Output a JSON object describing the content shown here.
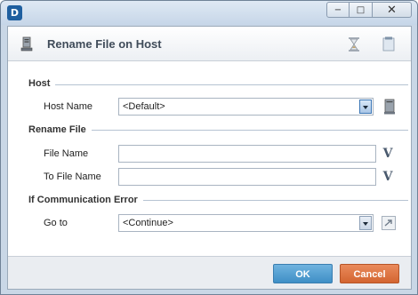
{
  "window": {
    "app_icon_text": "D",
    "minimize_glyph": "−",
    "maximize_glyph": "□",
    "close_glyph": "✕"
  },
  "header": {
    "title": "Rename File on Host",
    "left_icon": "host-computer-icon",
    "wait_icon": "hourglass-icon",
    "note_icon": "note-icon"
  },
  "sections": {
    "host": {
      "title": "Host",
      "host_name_label": "Host Name",
      "host_name_value": "<Default>"
    },
    "rename": {
      "title": "Rename File",
      "file_name_label": "File Name",
      "file_name_value": "",
      "to_file_name_label": "To File Name",
      "to_file_name_value": "",
      "variable_button": "V"
    },
    "error": {
      "title": "If Communication Error",
      "goto_label": "Go to",
      "goto_value": "<Continue>"
    }
  },
  "footer": {
    "ok_label": "OK",
    "cancel_label": "Cancel"
  },
  "colors": {
    "ok": "#4f9fd3",
    "cancel": "#df7743",
    "title_text": "#404c5a"
  }
}
